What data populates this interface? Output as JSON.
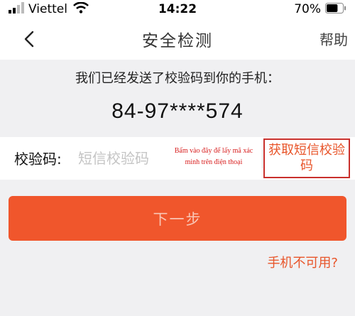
{
  "status_bar": {
    "carrier": "Viettel",
    "time": "14:22",
    "battery": "70%",
    "battery_level": 0.7,
    "icons": [
      "signal-icon",
      "wifi-icon",
      "battery-icon"
    ]
  },
  "nav": {
    "title": "安全检测",
    "help": "帮助",
    "back_icon": "chevron-left-icon"
  },
  "notice": "我们已经发送了校验码到你的手机：",
  "phone": "84-97****574",
  "code_field": {
    "label": "校验码:",
    "placeholder": "短信校验码",
    "value": ""
  },
  "annotation": "Bấm vào đây để lấy mã xác minh trên điện thoại",
  "get_code_button": "获取短信校验码",
  "next_button": "下一步",
  "phone_unavailable_link": "手机不可用?",
  "colors": {
    "accent": "#f0562c",
    "accent_text": "#e8552a",
    "annotation_red": "#d81e1e",
    "background": "#f0f0f2"
  }
}
